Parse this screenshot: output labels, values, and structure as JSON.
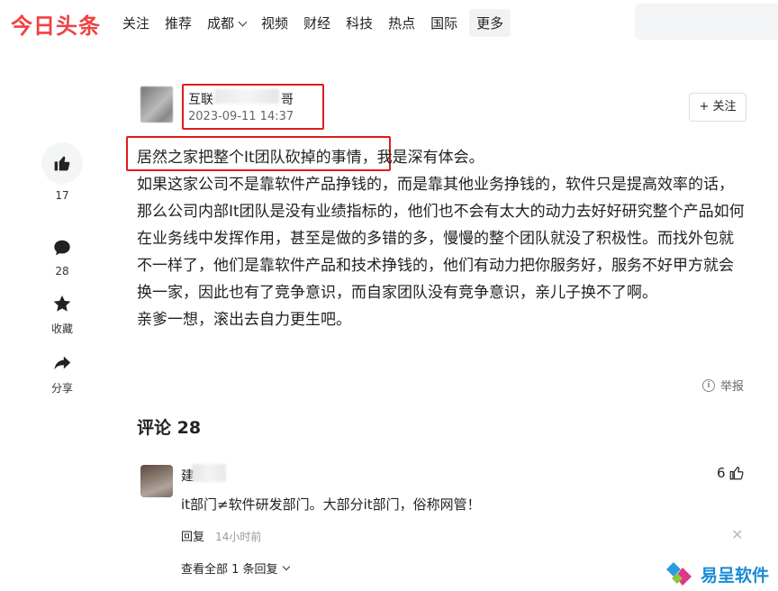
{
  "brand": {
    "logo": "今日头条"
  },
  "nav": {
    "items": [
      "关注",
      "推荐",
      "成都",
      "视频",
      "财经",
      "科技",
      "热点",
      "国际"
    ],
    "more": "更多"
  },
  "author": {
    "name_prefix": "互联",
    "name_suffix": "哥",
    "time": "2023-09-11 14:37",
    "follow": "+ 关注"
  },
  "actions": {
    "like_count": "17",
    "comment_count": "28",
    "favorite_label": "收藏",
    "share_label": "分享"
  },
  "article": {
    "highlighted": "居然之家把整个It团队砍掉的事情",
    "line1_rest": "，我是深有体会。",
    "body": "如果这家公司不是靠软件产品挣钱的，而是靠其他业务挣钱的，软件只是提高效率的话，那么公司内部It团队是没有业绩指标的，他们也不会有太大的动力去好好研究整个产品如何在业务线中发挥作用，甚至是做的多错的多，慢慢的整个团队就没了积极性。而找外包就不一样了，他们是靠软件产品和技术挣钱的，他们有动力把你服务好，服务不好甲方就会换一家，因此也有了竞争意识，而自家团队没有竞争意识，亲儿子换不了啊。",
    "closing": "亲爹一想，滚出去自力更生吧。",
    "report": "举报"
  },
  "comments": {
    "title": "评论 28",
    "items": [
      {
        "user_initial": "建",
        "likes": "6",
        "text": "it部门≠软件研发部门。大部分it部门，俗称网管！",
        "reply": "回复",
        "time": "14小时前",
        "view_all": "查看全部 1 条回复"
      }
    ]
  },
  "watermark": {
    "text": "易呈软件"
  },
  "colors": {
    "brand_red": "#f04142",
    "highlight_border": "#e01c1c",
    "watermark_blue": "#1a8ad6"
  }
}
